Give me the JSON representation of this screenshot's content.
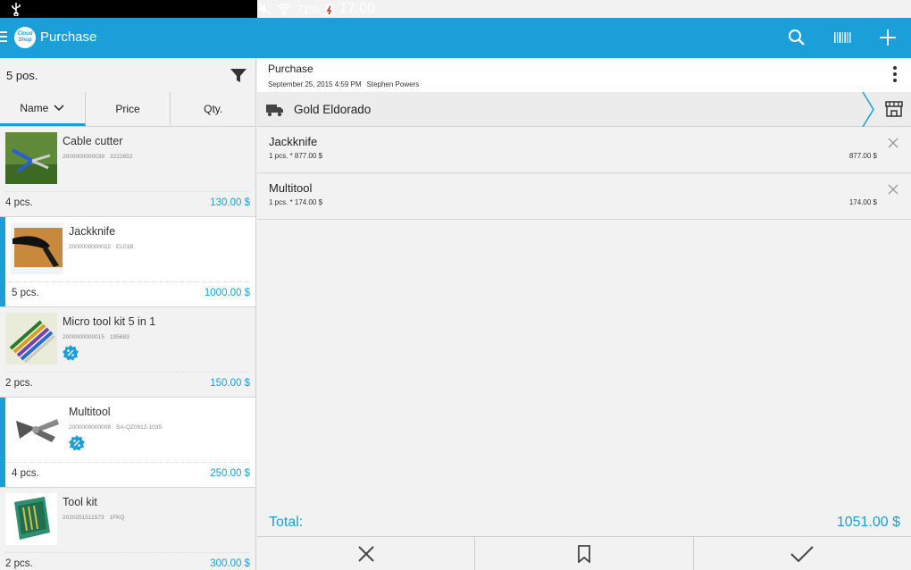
{
  "status": {
    "battery": "71%",
    "time": "17:00"
  },
  "appbar": {
    "logo_text": "Cloud Shop",
    "title": "Purchase"
  },
  "list": {
    "count": "5 pos.",
    "sort_tabs": [
      "Name",
      "Price",
      "Qty."
    ],
    "products": [
      {
        "name": "Cable cutter",
        "barcode": "2000000000039",
        "sku": "3222652",
        "qty": "4 pcs.",
        "price": "130.00 $",
        "discount": false,
        "selected": false
      },
      {
        "name": "Jackknife",
        "barcode": "2000000000022",
        "sku": "EL01B",
        "qty": "5 pcs.",
        "price": "1000.00 $",
        "discount": false,
        "selected": true
      },
      {
        "name": "Micro tool kit 5 in 1",
        "barcode": "2000000000015",
        "sku": "195683",
        "qty": "2 pcs.",
        "price": "150.00 $",
        "discount": true,
        "selected": false
      },
      {
        "name": "Multitool",
        "barcode": "2000000000008",
        "sku": "SA-QZ0912-1035",
        "qty": "4 pcs.",
        "price": "250.00 $",
        "discount": true,
        "selected": true
      },
      {
        "name": "Tool kit",
        "barcode": "2020251511573",
        "sku": "1FKQ",
        "qty": "2 pcs.",
        "price": "300.00 $",
        "discount": false,
        "selected": false
      }
    ]
  },
  "document": {
    "title": "Purchase",
    "date": "September 25, 2015 4:59 PM",
    "user": "Stephen Powers",
    "supplier": "Gold Eldorado",
    "lines": [
      {
        "name": "Jackknife",
        "detail": "1 pcs. * 877.00 $",
        "sum": "877.00 $"
      },
      {
        "name": "Multitool",
        "detail": "1 pcs. * 174.00 $",
        "sum": "174.00 $"
      }
    ],
    "total_label": "Total:",
    "total_value": "1051.00 $"
  },
  "colors": {
    "accent": "#1a9fd8",
    "statusbar": "#000000"
  }
}
